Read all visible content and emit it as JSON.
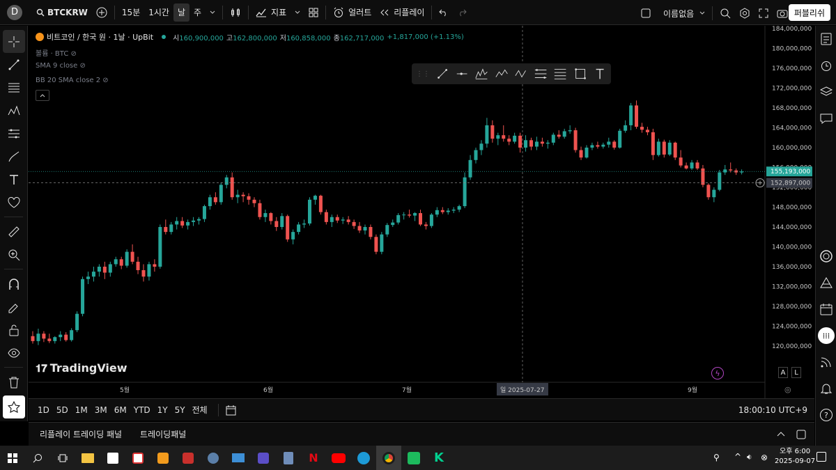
{
  "topbar": {
    "avatar": "D",
    "symbol": "BTCKRW",
    "intervals": [
      "15분",
      "1시간",
      "날",
      "주"
    ],
    "indicators_label": "지표",
    "alerts_label": "얼러트",
    "replay_label": "리플레이",
    "layout_name": "이름없음",
    "publish_label": "퍼블리쉬"
  },
  "legend": {
    "title": "비트코인 / 한국 원 · 1날 · UpBit",
    "o_label": "시",
    "o": "160,900,000",
    "h_label": "고",
    "h": "162,800,000",
    "l_label": "저",
    "l": "160,858,000",
    "c_label": "종",
    "c": "162,717,000",
    "change": "+1,817,000 (+1.13%)",
    "volume": "볼륨 · BTC",
    "sma": "SMA 9 close",
    "bb": "BB 20 SMA close 2"
  },
  "price_axis": {
    "ticks": [
      "184,000,000",
      "180,000,000",
      "176,000,000",
      "172,000,000",
      "168,000,000",
      "164,000,000",
      "160,000,000",
      "156,000,000",
      "152,000,000",
      "148,000,000",
      "144,000,000",
      "140,000,000",
      "136,000,000",
      "132,000,000",
      "128,000,000",
      "124,000,000",
      "120,000,000"
    ],
    "last_price": "155,193,000",
    "crosshair_price": "152,897,000",
    "auto_label": "A",
    "log_label": "L"
  },
  "time_axis": {
    "ticks": [
      "5월",
      "6월",
      "7월",
      "9월"
    ],
    "crosshair_date": "일 2025-07-27"
  },
  "watermark": "TradingView",
  "bottombar": {
    "ranges": [
      "1D",
      "5D",
      "1M",
      "3M",
      "6M",
      "YTD",
      "1Y",
      "5Y",
      "전체"
    ],
    "clock": "18:00:10 UTC+9"
  },
  "panel": {
    "tab1": "리플레이 트레이딩 패널",
    "tab2": "트레이딩패널"
  },
  "taskbar": {
    "time": "오후 6:00",
    "date": "2025-09-07"
  },
  "colors": {
    "up": "#26a69a",
    "down": "#ef5350",
    "last_price_bg": "#26a69a",
    "crosshair_bg": "#363a45"
  },
  "chart_data": {
    "type": "candlestick",
    "note_unit": "KRW millions",
    "ylim": [
      116,
      186
    ],
    "candles": [
      [
        122,
        123,
        120.5,
        121
      ],
      [
        121,
        123.5,
        120.2,
        122.5
      ],
      [
        122.5,
        123,
        120.8,
        121.5
      ],
      [
        121.5,
        122.5,
        120.6,
        121
      ],
      [
        121,
        122,
        120.5,
        121.8
      ],
      [
        121.8,
        123,
        121,
        122.3
      ],
      [
        122.3,
        122.8,
        120.9,
        121.2
      ],
      [
        121.2,
        123.6,
        120.9,
        123.2
      ],
      [
        123.2,
        127,
        122.8,
        126.5
      ],
      [
        126.5,
        134,
        126,
        133.5
      ],
      [
        133.5,
        135,
        132.5,
        134
      ],
      [
        134,
        136,
        133,
        135
      ],
      [
        135,
        136.5,
        134,
        136
      ],
      [
        136,
        137,
        133.5,
        134.8
      ],
      [
        134.8,
        137,
        134,
        136.5
      ],
      [
        136.5,
        138,
        136,
        137.5
      ],
      [
        137.5,
        138,
        135.5,
        136.2
      ],
      [
        136.2,
        139.5,
        135.8,
        139
      ],
      [
        139,
        140.5,
        136.5,
        137
      ],
      [
        137,
        138,
        134.5,
        135.3
      ],
      [
        135.3,
        136.5,
        133,
        134
      ],
      [
        134,
        137,
        133.2,
        136.5
      ],
      [
        136.5,
        137.5,
        135,
        136
      ],
      [
        136,
        144.5,
        135.6,
        144
      ],
      [
        144,
        145.5,
        142.5,
        143
      ],
      [
        143,
        145,
        142.5,
        144.5
      ],
      [
        144.5,
        146,
        143.5,
        145.2
      ],
      [
        145.2,
        146,
        143.8,
        144.3
      ],
      [
        144.3,
        145.5,
        143.5,
        145
      ],
      [
        145,
        146,
        144.2,
        145.3
      ],
      [
        145.3,
        146,
        144.5,
        145.6
      ],
      [
        145.6,
        148.5,
        145,
        148.2
      ],
      [
        148.2,
        150.5,
        147.5,
        150
      ],
      [
        150,
        151,
        148.5,
        149
      ],
      [
        149,
        153,
        148.5,
        152.5
      ],
      [
        152.5,
        154.5,
        151.8,
        154
      ],
      [
        154,
        155,
        149.5,
        150
      ],
      [
        150,
        151.5,
        148.8,
        150.5
      ],
      [
        150.5,
        151,
        149,
        150.2
      ],
      [
        150.2,
        150.8,
        148.5,
        149.5
      ],
      [
        149.5,
        150,
        148,
        148.8
      ],
      [
        148.8,
        149.5,
        145.5,
        146
      ],
      [
        146,
        147.5,
        145,
        146.8
      ],
      [
        146.8,
        147,
        144.5,
        145.2
      ],
      [
        145.2,
        146,
        143.2,
        144
      ],
      [
        144,
        146.8,
        143.5,
        146.2
      ],
      [
        146.2,
        146.5,
        141,
        141.5
      ],
      [
        141.5,
        143.5,
        140.5,
        143
      ],
      [
        143,
        145,
        142.5,
        144.5
      ],
      [
        144.5,
        145.5,
        143.8,
        144.7
      ],
      [
        144.7,
        150,
        144.3,
        149.5
      ],
      [
        149.5,
        150.5,
        148.5,
        150.3
      ],
      [
        150.3,
        150.5,
        146.5,
        147
      ],
      [
        147,
        147.5,
        144.5,
        145
      ],
      [
        145,
        146.5,
        144,
        146
      ],
      [
        146,
        146.5,
        144.8,
        145.3
      ],
      [
        145.3,
        146,
        144.6,
        145.5
      ],
      [
        145.5,
        146.2,
        144.5,
        145
      ],
      [
        145,
        145.5,
        143.6,
        144.2
      ],
      [
        144.2,
        145,
        142.8,
        143.3
      ],
      [
        143.3,
        144.5,
        142.5,
        144
      ],
      [
        144,
        144.5,
        141.5,
        142
      ],
      [
        142,
        142.5,
        138.5,
        139
      ],
      [
        139,
        143,
        138.5,
        142.5
      ],
      [
        142.5,
        144.8,
        142,
        144.4
      ],
      [
        144.4,
        145.5,
        144,
        144.9
      ],
      [
        144.9,
        146.8,
        144.5,
        146.4
      ],
      [
        146.4,
        147,
        145.5,
        146.5
      ],
      [
        146.5,
        147.5,
        145.9,
        146.3
      ],
      [
        146.3,
        147,
        145.2,
        146.8
      ],
      [
        146.8,
        147.5,
        144.2,
        144.5
      ],
      [
        144.5,
        145,
        143.5,
        144.2
      ],
      [
        144.2,
        146.8,
        143.8,
        146.5
      ],
      [
        146.5,
        148,
        146,
        147.4
      ],
      [
        147.4,
        148,
        146.6,
        147
      ],
      [
        147,
        147.8,
        146.5,
        147.3
      ],
      [
        147.3,
        148,
        146.8,
        147.5
      ],
      [
        147.5,
        148.5,
        147,
        148.2
      ],
      [
        148.2,
        155,
        147.8,
        154
      ],
      [
        154,
        158.5,
        153.5,
        157.5
      ],
      [
        157.5,
        160,
        156.8,
        159.5
      ],
      [
        159.5,
        161.5,
        158.5,
        160.8
      ],
      [
        160.8,
        166,
        160,
        164.5
      ],
      [
        164.5,
        165.5,
        161,
        161.8
      ],
      [
        161.8,
        163,
        160.5,
        162.5
      ],
      [
        162.5,
        164.5,
        161.2,
        161.8
      ],
      [
        161.8,
        162.5,
        160.5,
        161.2
      ],
      [
        161.2,
        163,
        160.8,
        162.4
      ],
      [
        162.4,
        163,
        159,
        160
      ],
      [
        160,
        162.5,
        159.2,
        161.5
      ],
      [
        161.5,
        162,
        159.5,
        160.2
      ],
      [
        160.2,
        162.2,
        159.5,
        161.2
      ],
      [
        161.2,
        162,
        160.2,
        160.8
      ],
      [
        160.8,
        161.5,
        159.8,
        161
      ],
      [
        161,
        163,
        160.5,
        162.6
      ],
      [
        162.6,
        163.5,
        161.8,
        162.2
      ],
      [
        162.2,
        163.8,
        161.8,
        163.3
      ],
      [
        163.3,
        164.5,
        162.8,
        163.5
      ],
      [
        163.5,
        164,
        159,
        159.5
      ],
      [
        159.5,
        160.2,
        157.5,
        158
      ],
      [
        158,
        160.5,
        157.8,
        160
      ],
      [
        160,
        161,
        159.5,
        160.5
      ],
      [
        160.5,
        161.2,
        159.8,
        160.2
      ],
      [
        160.2,
        161,
        159.8,
        160.6
      ],
      [
        160.6,
        162,
        160,
        161.2
      ],
      [
        161.2,
        161.5,
        159.6,
        160
      ],
      [
        160,
        163.8,
        159.8,
        163.4
      ],
      [
        163.4,
        165.5,
        163,
        164.5
      ],
      [
        164.5,
        169,
        163.5,
        168.5
      ],
      [
        168.5,
        169.5,
        163.8,
        164.2
      ],
      [
        164.2,
        165,
        163,
        163.6
      ],
      [
        163.6,
        164.2,
        162.5,
        163.1
      ],
      [
        163.1,
        163.8,
        157.5,
        158.5
      ],
      [
        158.5,
        161.8,
        158.2,
        161.2
      ],
      [
        161.2,
        161.6,
        158,
        158.6
      ],
      [
        158.6,
        161.5,
        158.3,
        161
      ],
      [
        161,
        161.2,
        157.5,
        158
      ],
      [
        158,
        159.5,
        156,
        156.4
      ],
      [
        156.4,
        157,
        155.6,
        155.8
      ],
      [
        155.8,
        157.5,
        155.5,
        157
      ],
      [
        157,
        157.5,
        155.5,
        155.8
      ],
      [
        155.8,
        156.5,
        152,
        152.5
      ],
      [
        152.5,
        152.8,
        149.5,
        150
      ],
      [
        150,
        152,
        149,
        151.5
      ],
      [
        151.5,
        155.5,
        151.2,
        155
      ],
      [
        155,
        156.5,
        154.5,
        155.6
      ],
      [
        155.6,
        157,
        155,
        155.4
      ],
      [
        155.4,
        155.8,
        154.5,
        155
      ],
      [
        155,
        155.6,
        154.6,
        155.2
      ]
    ]
  }
}
